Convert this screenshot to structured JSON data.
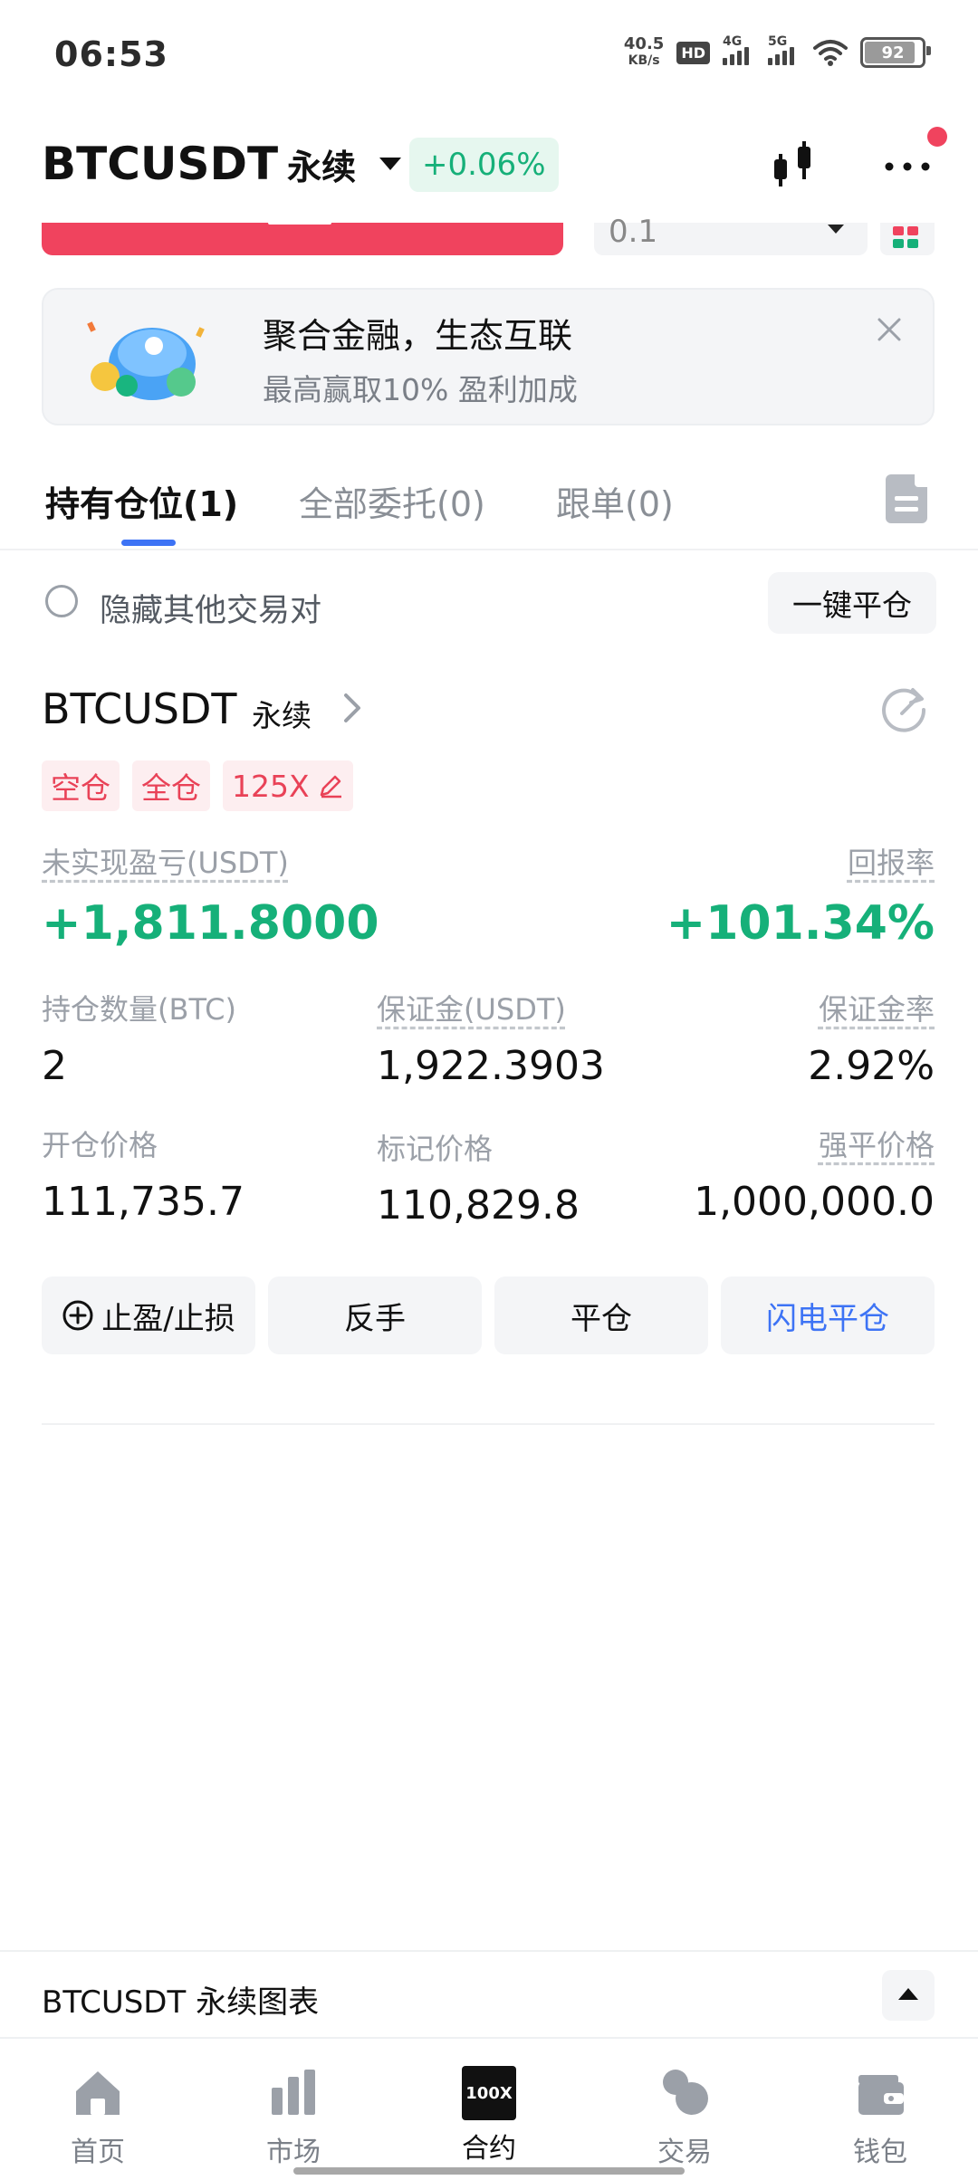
{
  "status_bar": {
    "time": "06:53",
    "net_speed_value": "40.5",
    "net_speed_unit": "KB/s",
    "hd_label": "HD",
    "sim1_label": "4G",
    "sim2_label": "5G",
    "battery": "92"
  },
  "header": {
    "symbol": "BTCUSDT",
    "contract_type": "永续",
    "change": "+0.06%",
    "colors": {
      "up": "#16b079",
      "down": "#f0435e",
      "accent": "#3d73f5"
    }
  },
  "order_form_partial": {
    "quantity_value": "0.1"
  },
  "banner": {
    "title": "聚合金融，生态互联",
    "subtitle": "最高赢取10% 盈利加成"
  },
  "tabs": [
    {
      "label": "持有仓位(1)",
      "active": true
    },
    {
      "label": "全部委托(0)",
      "active": false
    },
    {
      "label": "跟单(0)",
      "active": false
    }
  ],
  "filter": {
    "hide_other_pairs_label": "隐藏其他交易对",
    "close_all_label": "一键平仓"
  },
  "position": {
    "symbol": "BTCUSDT",
    "contract_type": "永续",
    "tags": [
      "空仓",
      "全仓",
      "125X"
    ],
    "unrealized_pnl_label": "未实现盈亏(USDT)",
    "unrealized_pnl": "+1,811.8000",
    "roe_label": "回报率",
    "roe": "+101.34%",
    "size_label": "持仓数量(BTC)",
    "size": "2",
    "margin_label": "保证金(USDT)",
    "margin": "1,922.3903",
    "margin_ratio_label": "保证金率",
    "margin_ratio": "2.92%",
    "entry_price_label": "开仓价格",
    "entry_price": "111,735.7",
    "mark_price_label": "标记价格",
    "mark_price": "110,829.8",
    "liq_price_label": "强平价格",
    "liq_price": "1,000,000.0",
    "actions": {
      "tp_sl": "止盈/止损",
      "reverse": "反手",
      "close": "平仓",
      "flash_close": "闪电平仓"
    }
  },
  "chart_bar": {
    "label": "BTCUSDT 永续图表"
  },
  "bottom_nav": [
    {
      "label": "首页",
      "icon": "home-icon",
      "active": false
    },
    {
      "label": "市场",
      "icon": "market-icon",
      "active": false
    },
    {
      "label": "合约",
      "icon": "futures-icon",
      "badge": "100X",
      "active": true
    },
    {
      "label": "交易",
      "icon": "trade-icon",
      "active": false
    },
    {
      "label": "钱包",
      "icon": "wallet-icon",
      "active": false
    }
  ]
}
